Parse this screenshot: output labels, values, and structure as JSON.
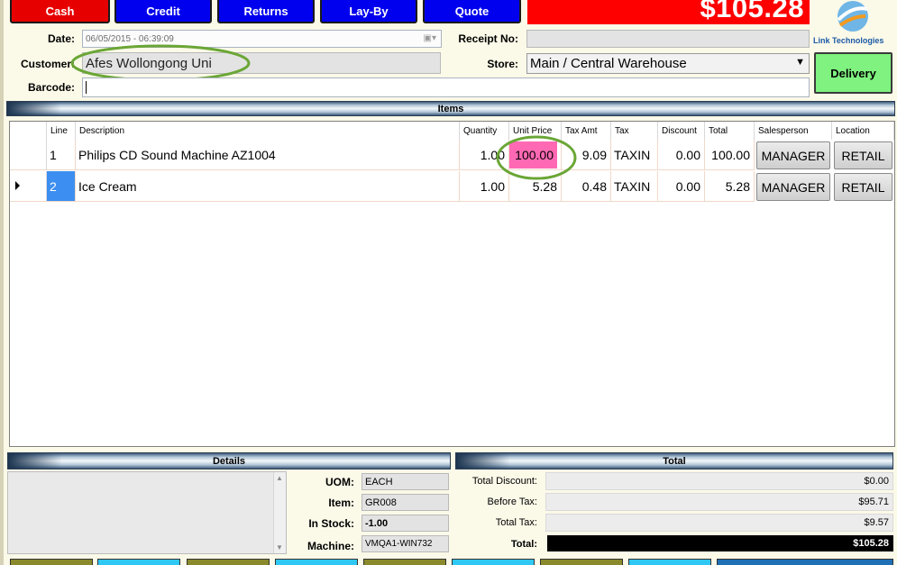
{
  "toolbar": {
    "cash_label": "Cash",
    "credit_label": "Credit",
    "returns_label": "Returns",
    "layby_label": "Lay-By",
    "quote_label": "Quote"
  },
  "total_display": "$105.28",
  "logo_text": "Link Technologies",
  "form": {
    "date_label": "Date:",
    "date_value": "06/05/2015 - 06:39:09",
    "receipt_label": "Receipt No:",
    "receipt_value": "",
    "customer_label": "Customer:",
    "customer_value": "Afes Wollongong Uni",
    "store_label": "Store:",
    "store_value": "Main / Central Warehouse",
    "barcode_label": "Barcode:",
    "barcode_value": "",
    "delivery_label": "Delivery"
  },
  "items_title": "Items",
  "columns": {
    "line": "Line",
    "description": "Description",
    "quantity": "Quantity",
    "unit_price": "Unit Price",
    "tax_amt": "Tax Amt",
    "tax": "Tax",
    "discount": "Discount",
    "total": "Total",
    "salesperson": "Salesperson",
    "location": "Location"
  },
  "rows": [
    {
      "line": "1",
      "description": "Philips CD Sound Machine AZ1004",
      "quantity": "1.00",
      "unit_price": "100.00",
      "tax_amt": "9.09",
      "tax": "TAXIN",
      "discount": "0.00",
      "total": "100.00",
      "salesperson": "MANAGER",
      "location": "RETAIL"
    },
    {
      "line": "2",
      "description": "Ice Cream",
      "quantity": "1.00",
      "unit_price": "5.28",
      "tax_amt": "0.48",
      "tax": "TAXIN",
      "discount": "0.00",
      "total": "5.28",
      "salesperson": "MANAGER",
      "location": "RETAIL"
    }
  ],
  "details": {
    "title": "Details",
    "uom_label": "UOM:",
    "uom_value": "EACH",
    "item_label": "Item:",
    "item_value": "GR008",
    "stock_label": "In Stock:",
    "stock_value": "-1.00",
    "machine_label": "Machine:",
    "machine_value": "VMQA1-WIN732"
  },
  "totals": {
    "title": "Total",
    "discount_label": "Total Discount:",
    "discount_value": "$0.00",
    "before_tax_label": "Before Tax:",
    "before_tax_value": "$95.71",
    "tax_label": "Total Tax:",
    "tax_value": "$9.57",
    "total_label": "Total:",
    "total_value": "$105.28"
  },
  "colors": {
    "cash": "#e00000",
    "blue_button": "#0000ff",
    "total_banner": "#ff0000",
    "delivery": "#80ff80",
    "highlight": "#ff69b4",
    "annotation": "#6aa636"
  }
}
